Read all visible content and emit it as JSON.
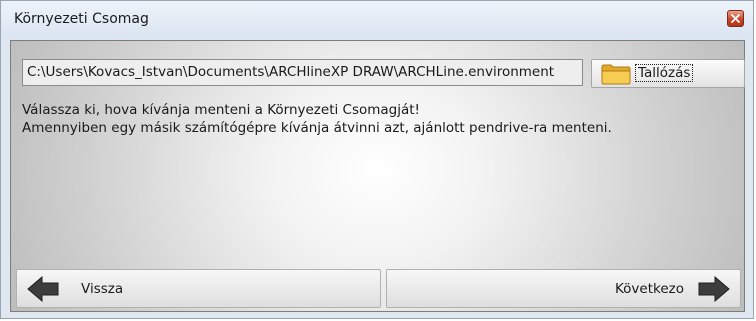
{
  "window": {
    "title": "Környezeti Csomag"
  },
  "path_field": {
    "value": "C:\\Users\\Kovacs_Istvan\\Documents\\ARCHlineXP DRAW\\ARCHLine.environment"
  },
  "browse_button": {
    "label": "Tallózás",
    "icon": "folder-icon"
  },
  "message": {
    "line1": "Válassza ki, hova kívánja menteni a Környezeti Csomagját!",
    "line2": "Amennyiben egy másik számítógépre kívánja átvinni azt, ajánlott pendrive-ra menteni."
  },
  "nav": {
    "back_label": "Vissza",
    "back_icon": "arrow-left-icon",
    "next_label": "Következo",
    "next_icon": "arrow-right-icon"
  },
  "colors": {
    "close_button": "#c9452a",
    "folder": "#f2c94c",
    "arrow": "#3a3a3a"
  }
}
